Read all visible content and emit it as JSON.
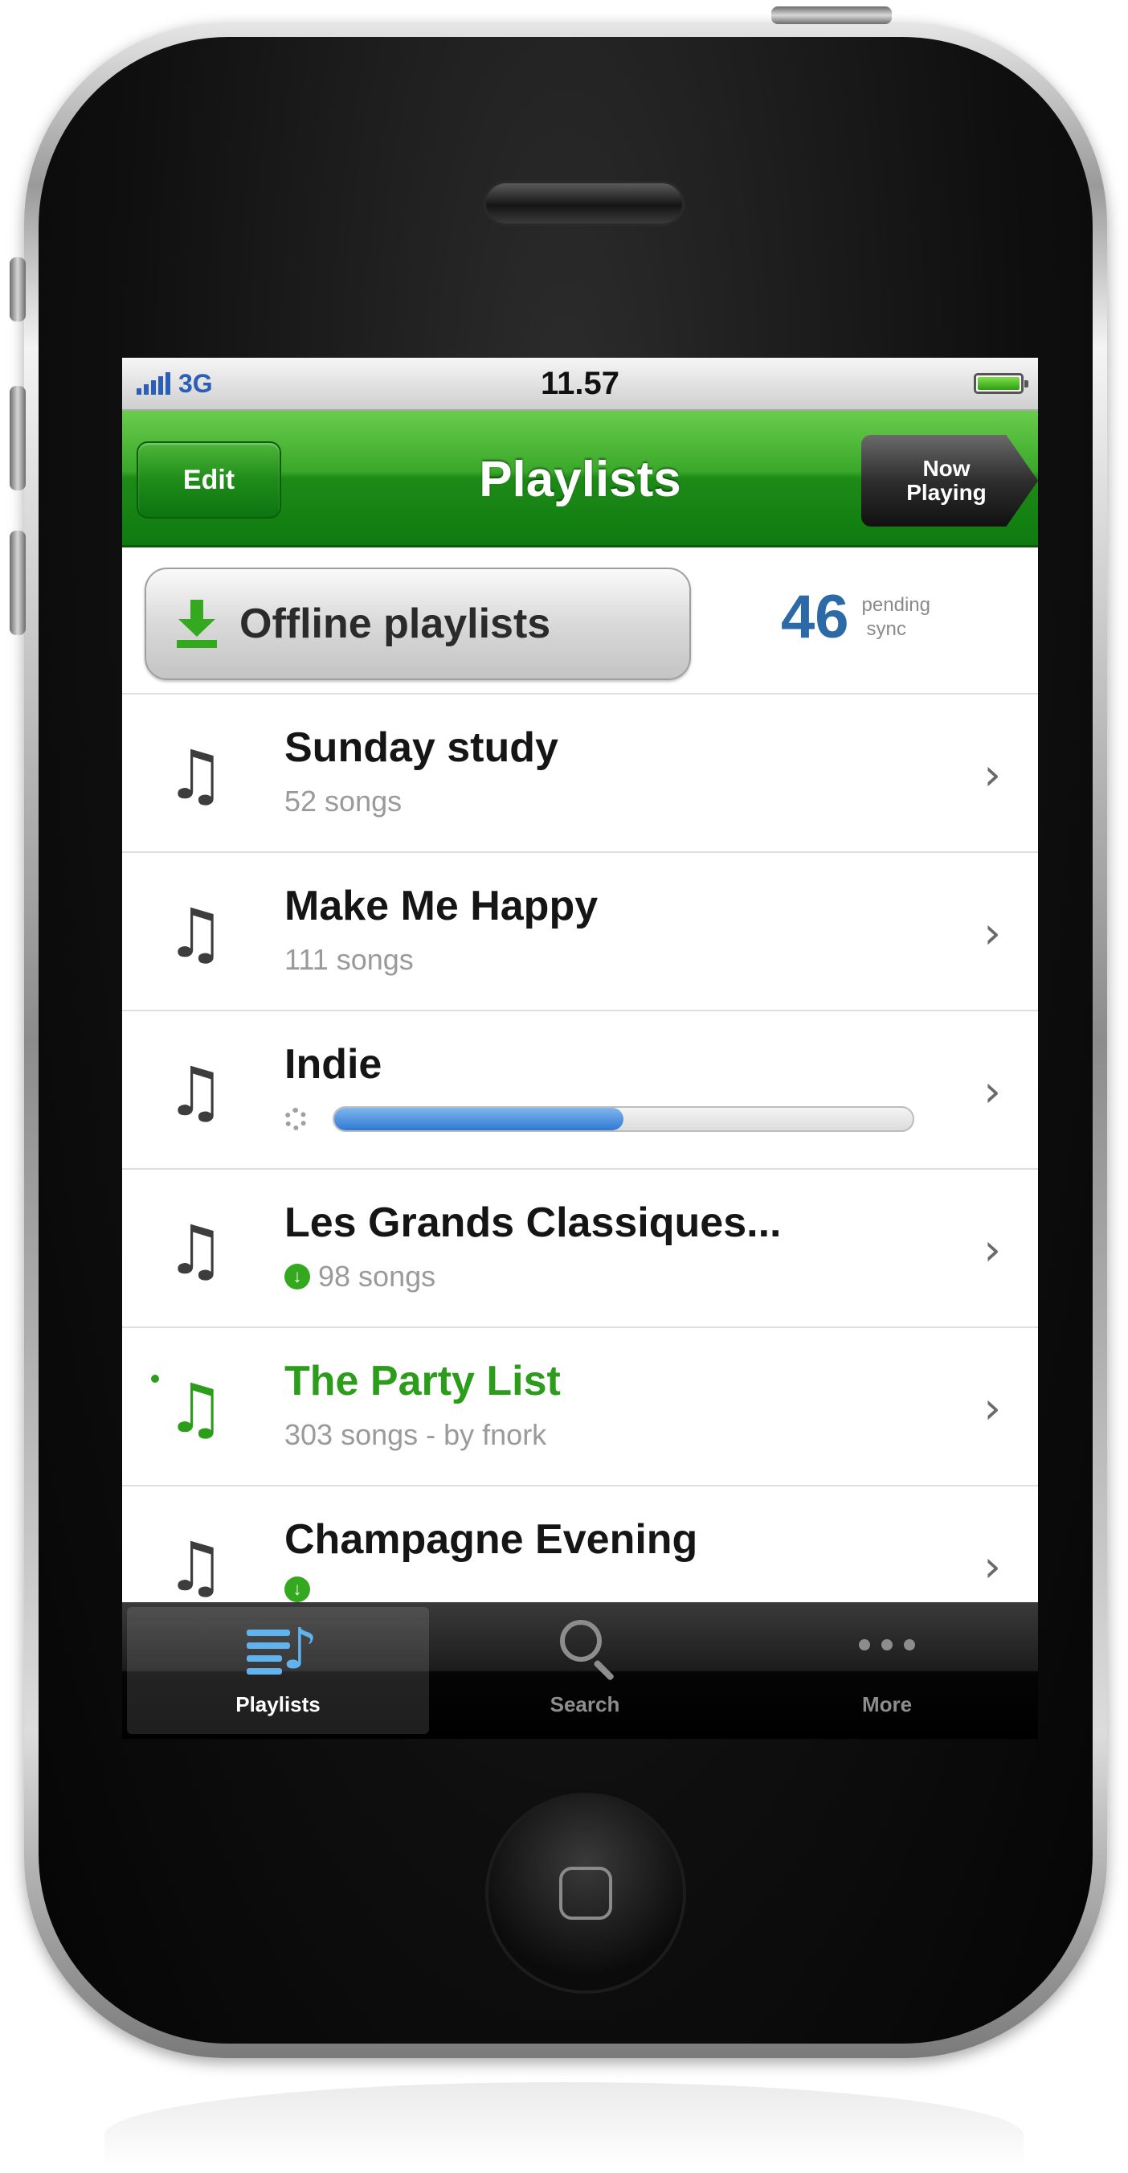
{
  "status_bar": {
    "network": "3G",
    "time": "11.57"
  },
  "nav": {
    "edit_label": "Edit",
    "title": "Playlists",
    "now_playing_line1": "Now",
    "now_playing_line2": "Playing"
  },
  "offline": {
    "button_label": "Offline playlists",
    "pending_count": "46",
    "pending_line1": "pending",
    "pending_line2": "sync"
  },
  "playlists": [
    {
      "name": "Sunday study",
      "subtitle": "52 songs"
    },
    {
      "name": "Make Me Happy",
      "subtitle": "111 songs"
    },
    {
      "name": "Indie",
      "sync_progress": 0.5
    },
    {
      "name": "Les Grands Classiques...",
      "subtitle": "98 songs"
    },
    {
      "name": "The Party List",
      "subtitle": "303 songs - by fnork"
    },
    {
      "name": "Champagne Evening",
      "subtitle": ""
    }
  ],
  "tabs": [
    {
      "label": "Playlists",
      "icon": "playlist-icon"
    },
    {
      "label": "Search",
      "icon": "search-icon"
    },
    {
      "label": "More",
      "icon": "more-dots-icon"
    }
  ],
  "colors": {
    "brand_green": "#2c9d1a",
    "accent_blue": "#2f79d3"
  }
}
